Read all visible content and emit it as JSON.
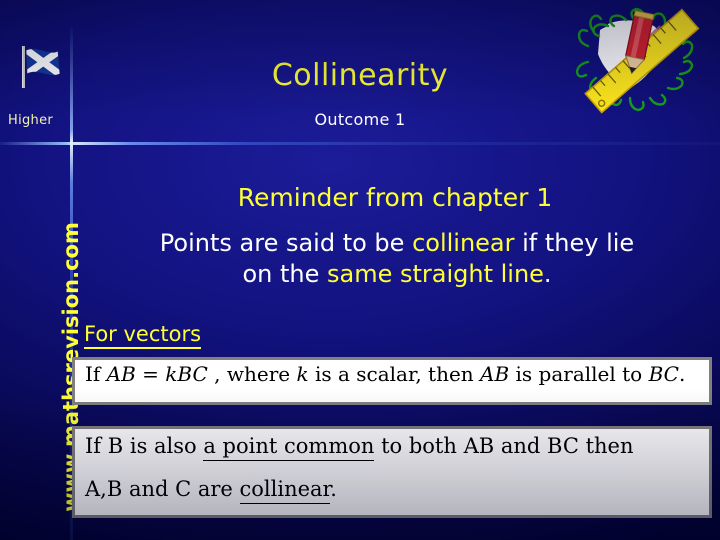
{
  "slide": {
    "background_color": "#121280",
    "accent_yellow": "#ffff33",
    "text_white": "#ffffff",
    "box_border_color": "#808080",
    "box_fill_color": "#ffffff"
  },
  "header": {
    "title": "Collinearity",
    "subtitle": "Outcome 1",
    "level_label": "Higher",
    "flag_icon": "scottish-saltire-flag-icon",
    "clipart_icon": "ruler-and-pencil-clipart"
  },
  "sidebar": {
    "website": "www.mathsrevision.com"
  },
  "body": {
    "section_heading": "Reminder from chapter 1",
    "statement": {
      "line1_pre": "Points are said to be ",
      "line1_highlight": "collinear",
      "line1_post": " if they lie",
      "line2_pre": "on the ",
      "line2_highlight": "same straight line",
      "line2_post": "."
    },
    "for_vectors_label": "For vectors"
  },
  "equation_box_1": {
    "prefix": "If ",
    "vector_ab": "AB",
    "equals": " = ",
    "scalar_k": "k",
    "vector_bc": "BC",
    "middle": " , where ",
    "k_italic": "k",
    "middle2": " is a scalar, then ",
    "ab_italic": "AB",
    "middle3": " is parallel to ",
    "bc_italic": "BC",
    "suffix": "."
  },
  "equation_box_2": {
    "line1_pre": "If B is also ",
    "line1_underlined": "a point common",
    "line1_post": " to both AB and BC then",
    "line2_pre": "A,B and C are ",
    "line2_underlined": "collinear",
    "line2_post": "."
  }
}
